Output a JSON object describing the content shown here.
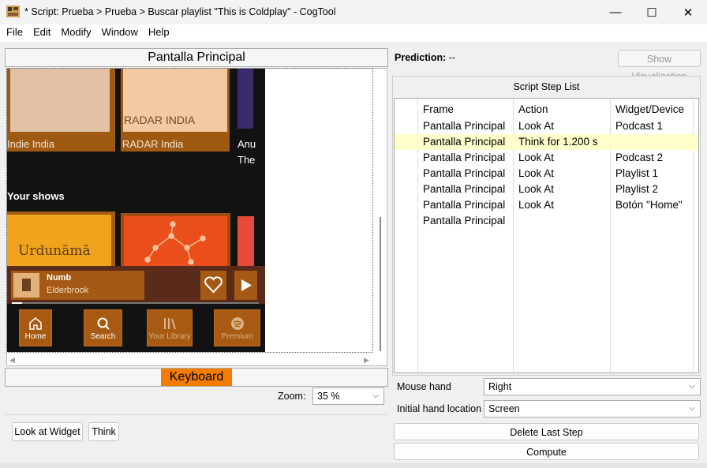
{
  "window": {
    "title": "* Script: Prueba > Prueba > Buscar playlist \"This is Coldplay\" - CogTool",
    "minimize": "—",
    "maximize": "☐",
    "close": "✕"
  },
  "menu": [
    "File",
    "Edit",
    "Modify",
    "Window",
    "Help"
  ],
  "frame": {
    "title": "Pantalla Principal",
    "keyboard_label": "Keyboard"
  },
  "phone": {
    "card_label_1": "RADAR INDIA",
    "card_caption_1": "Indie India",
    "card_caption_2": "RADAR India",
    "card_caption_3a": "Anu",
    "card_caption_3b": "The",
    "section_title": "Your shows",
    "podcast_text": "Urdunāmā",
    "track_title": "Numb",
    "track_artist": "Elderbrook",
    "nav": [
      "Home",
      "Search",
      "Your Library",
      "Premium"
    ]
  },
  "zoom": {
    "label": "Zoom:",
    "value": "35 %"
  },
  "left_buttons": {
    "look_at_widget": "Look at Widget",
    "think": "Think"
  },
  "prediction": {
    "label": "Prediction:",
    "value": "--",
    "show_vis": "Show Visualization"
  },
  "script": {
    "title": "Script Step List",
    "columns": [
      "Frame",
      "Action",
      "Widget/Device"
    ],
    "rows": [
      {
        "frame": "Pantalla Principal",
        "action": "Look At",
        "widget": "Podcast 1"
      },
      {
        "frame": "Pantalla Principal",
        "action": "Think for 1.200 s",
        "widget": ""
      },
      {
        "frame": "Pantalla Principal",
        "action": "Look At",
        "widget": "Podcast 2"
      },
      {
        "frame": "Pantalla Principal",
        "action": "Look At",
        "widget": "Playlist 1"
      },
      {
        "frame": "Pantalla Principal",
        "action": "Look At",
        "widget": "Playlist 2"
      },
      {
        "frame": "Pantalla Principal",
        "action": "Look At",
        "widget": "Botón \"Home\""
      },
      {
        "frame": "Pantalla Principal",
        "action": "",
        "widget": ""
      }
    ]
  },
  "mouse_hand": {
    "label": "Mouse hand",
    "value": "Right"
  },
  "hand_location": {
    "label": "Initial hand location",
    "value": "Screen"
  },
  "actions": {
    "delete_last": "Delete Last Step",
    "compute": "Compute"
  }
}
